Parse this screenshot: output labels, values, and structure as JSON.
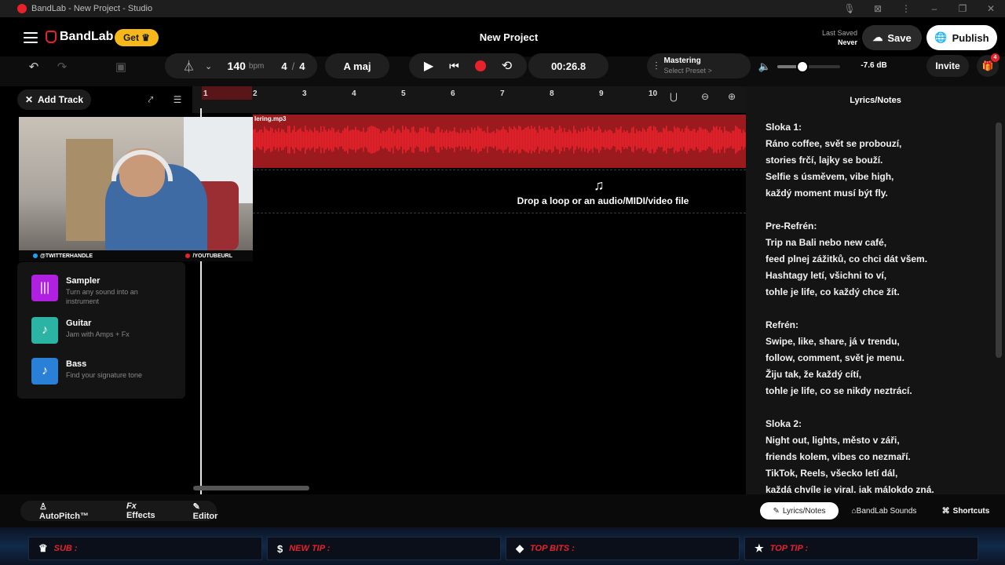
{
  "window": {
    "title": "BandLab - New Project - Studio"
  },
  "header": {
    "brand": "BandLab",
    "get_label": "Get",
    "project_title": "New Project",
    "last_saved_label": "Last Saved",
    "last_saved_value": "Never",
    "save_label": "Save",
    "publish_label": "Publish"
  },
  "toolbar": {
    "bpm_value": "140",
    "bpm_unit": "bpm",
    "time_sig_num": "4",
    "time_sig_sep": "/",
    "time_sig_den": "4",
    "key": "A maj",
    "time_display": "00:26.8",
    "mastering_title": "Mastering",
    "mastering_sub": "Select Preset >",
    "volume_db": "-7.6 dB",
    "invite_label": "Invite",
    "gift_badge": "4",
    "volume_level": 0.4
  },
  "left": {
    "add_track_label": "Add Track",
    "instruments": [
      {
        "name": "Sampler",
        "desc": "Turn any sound into an instrument",
        "color": "#b020e0"
      },
      {
        "name": "Guitar",
        "desc": "Jam with Amps + Fx",
        "color": "#2bb3a3"
      },
      {
        "name": "Bass",
        "desc": "Find your signature tone",
        "color": "#2a7fd6"
      }
    ]
  },
  "webcam": {
    "twitter": "@TWITTERHANDLE",
    "youtube": "/YOUTUBEURL"
  },
  "timeline": {
    "ruler": [
      "1",
      "2",
      "3",
      "4",
      "5",
      "6",
      "7",
      "8",
      "9",
      "10"
    ],
    "clip_name": "lering.mp3",
    "drop_text": "Drop a loop or an audio/MIDI/video file"
  },
  "lyrics_panel": {
    "title": "Lyrics/Notes",
    "lines": [
      "Sloka 1:",
      "Ráno coffee, svět se probouzí,",
      "stories frčí, lajky se bouží.",
      "Selfie s úsměvem, vibe high,",
      "každý moment musí být fly.",
      "",
      "Pre-Refrén:",
      "Trip na Bali nebo new café,",
      "feed plnej zážitků, co chci dát všem.",
      "Hashtagy letí, všichni to ví,",
      "tohle je life, co každý chce žít.",
      "",
      "Refrén:",
      "Swipe, like, share, já v trendu,",
      "follow, comment, svět je menu.",
      "Žiju tak, že každý cítí,",
      "tohle je life, co se nikdy neztrácí.",
      "",
      "Sloka 2:",
      "Night out, lights, město v záři,",
      "friends kolem, vibes co nezmaří.",
      "TikTok, Reels, všecko letí dál,",
      "každá chvíle je viral, jak málokdo zná."
    ]
  },
  "bottom": {
    "autopitch": "AutoPitch™",
    "effects": "Effects",
    "editor": "Editor",
    "lyrics_tab": "Lyrics/Notes",
    "bandlab_sounds": "BandLab Sounds",
    "shortcuts": "Shortcuts"
  },
  "overlay": {
    "sub": "SUB :",
    "new_tip": "NEW TIP :",
    "top_bits": "TOP BITS :",
    "top_tip": "TOP TIP :"
  }
}
